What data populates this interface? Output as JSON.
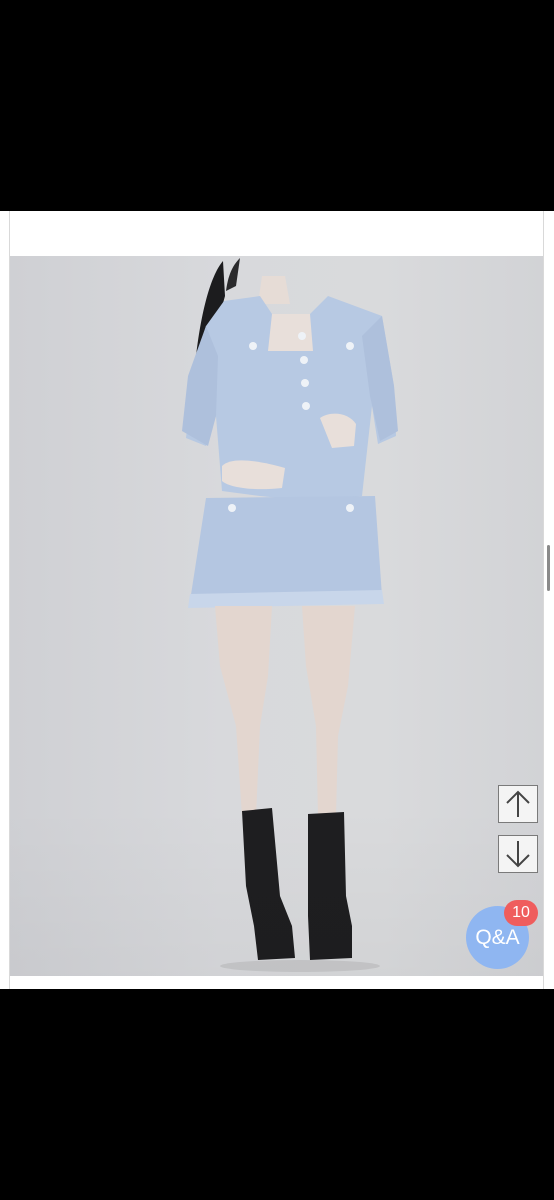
{
  "product_photo": {
    "icon": "model-photo"
  },
  "scroll_controls": {
    "up_icon": "arrow-up-icon",
    "down_icon": "arrow-down-icon"
  },
  "qa_button": {
    "label": "Q&A",
    "badge_count": "10"
  },
  "colors": {
    "background": "#000000",
    "page": "#ffffff",
    "qa_button": "#8fb6f1",
    "badge": "#ef5d5d"
  }
}
